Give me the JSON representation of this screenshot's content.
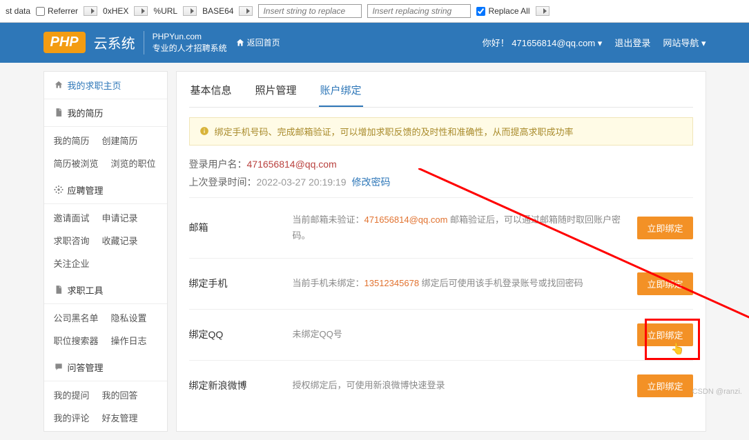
{
  "toolbar": {
    "st_data": "st data",
    "referrer": "Referrer",
    "hex": "0xHEX",
    "url": "%URL",
    "base64": "BASE64",
    "insert1": "Insert string to replace",
    "insert2": "Insert replacing string",
    "replace_all": "Replace All"
  },
  "header": {
    "logo": "PHP",
    "logo_cn": "云系统",
    "domain": "PHPYun.com",
    "slogan": "专业的人才招聘系统",
    "back_home": "返回首页",
    "greeting": "你好！",
    "user": "471656814@qq.com",
    "logout": "退出登录",
    "sitenav": "网站导航"
  },
  "sidebar": {
    "groups": [
      {
        "title": "我的求职主页",
        "hl": true,
        "icon": "home",
        "items": []
      },
      {
        "title": "我的简历",
        "icon": "doc",
        "items": [
          "我的简历",
          "创建简历",
          "简历被浏览",
          "浏览的职位"
        ]
      },
      {
        "title": "应聘管理",
        "icon": "gear",
        "items": [
          "邀请面试",
          "申请记录",
          "求职咨询",
          "收藏记录",
          "关注企业"
        ]
      },
      {
        "title": "求职工具",
        "icon": "doc",
        "items": [
          "公司黑名单",
          "隐私设置",
          "职位搜索器",
          "操作日志"
        ]
      },
      {
        "title": "问答管理",
        "icon": "chat",
        "items": [
          "我的提问",
          "我的回答",
          "我的评论",
          "好友管理"
        ]
      }
    ]
  },
  "tabs": [
    {
      "label": "基本信息",
      "active": false
    },
    {
      "label": "照片管理",
      "active": false
    },
    {
      "label": "账户绑定",
      "active": true
    }
  ],
  "notice": "绑定手机号码、完成邮箱验证，可以增加求职反馈的及时性和准确性，从而提高求职成功率",
  "login_info": {
    "user_label": "登录用户名：",
    "user_value": "471656814@qq.com",
    "last_label": "上次登录时间：",
    "last_value": "2022-03-27 20:19:19",
    "change_pwd": "修改密码"
  },
  "bindings": [
    {
      "label": "邮箱",
      "desc_pre": "当前邮箱未验证：",
      "value": "471656814@qq.com",
      "desc_post": " 邮箱验证后，可以通过邮箱随时取回账户密码。",
      "btn": "立即绑定"
    },
    {
      "label": "绑定手机",
      "desc_pre": "当前手机未绑定：",
      "value": "13512345678",
      "desc_post": " 绑定后可使用该手机登录账号或找回密码",
      "btn": "立即绑定"
    },
    {
      "label": "绑定QQ",
      "desc_pre": "",
      "value": "",
      "desc_post": "未绑定QQ号",
      "btn": "立即绑定"
    },
    {
      "label": "绑定新浪微博",
      "desc_pre": "",
      "value": "",
      "desc_post": "授权绑定后，可使用新浪微博快速登录",
      "btn": "立即绑定"
    }
  ],
  "watermark": "CSDN @ranzi."
}
